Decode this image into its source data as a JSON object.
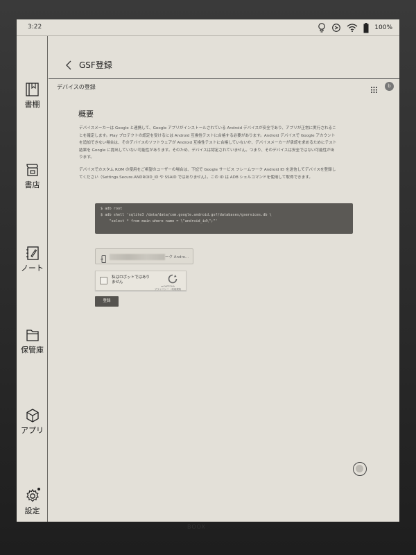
{
  "status_bar": {
    "time": "3:22",
    "battery": "100%",
    "icons": [
      "lightbulb-icon",
      "refresh-icon",
      "wifi-icon",
      "battery-icon"
    ]
  },
  "sidebar": {
    "items": [
      {
        "label": "書棚",
        "icon": "book-icon"
      },
      {
        "label": "書店",
        "icon": "store-icon"
      },
      {
        "label": "ノート",
        "icon": "note-icon"
      },
      {
        "label": "保管庫",
        "icon": "folder-icon"
      },
      {
        "label": "アプリ",
        "icon": "cube-icon"
      },
      {
        "label": "設定",
        "icon": "gear-icon"
      }
    ]
  },
  "header": {
    "title": "GSF登録",
    "back_icon": "chevron-left-icon"
  },
  "page": {
    "subtitle": "デバイスの登録",
    "avatar_letter": "b",
    "heading": "概要",
    "paragraph1": "デバイスメーカーは Google と連携して、Google アプリがインストールされている Android デバイスが安全であり、アプリが正常に実行されることを確定します。Play プロテクトの認定を受けるには Android 互換性テストに合格する必要があります。Android デバイスで Google アカウントを追加できない場合は、そのデバイスのソフトウェアが Android 互換性テストに合格していないか、デバイスメーカーが承認を求めるためにテスト結果を Google に提出していない可能性があります。そのため、デバイスは認定されていません。つまり、そのデバイスは安全ではない可能性があります。",
    "paragraph2": "デバイスでカスタム ROM の使用をご希望のユーザーの場合は、下記で Google サービス フレームワーク Android ID を送信してデバイスを登録してください（Settings.Secure.ANDROID_ID や SSAID ではありません）。この ID は ADB シェルコマンドを使用して取得できます。",
    "code_lines": [
      "$ adb root",
      "$ adb shell 'sqlite3 /data/data/com.google.android.gsf/databases/gservices.db \\",
      "    \"select * from main where name = \\\"android_id\\\";\"'"
    ],
    "account_text": "ーク Andro...",
    "recaptcha_label": "私はロボットではありません",
    "recaptcha_brand": "reCAPTCHA",
    "recaptcha_small": "プライバシー・利用規約",
    "register_button": "登録"
  },
  "bottom": {
    "brand": "BOOX"
  }
}
